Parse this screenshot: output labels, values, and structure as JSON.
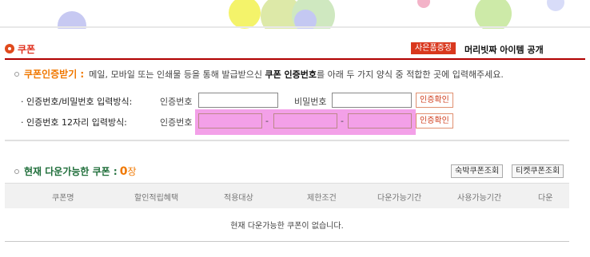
{
  "header": {
    "section_title": "쿠폰",
    "gift_badge": "사은품증정",
    "gift_link": "머리빗짜 아이템 공개"
  },
  "auth": {
    "title": "쿠폰인증받기 :",
    "desc_pre": "메일, 모바일 또는 인쇄물 등을 통해 발급받으신",
    "desc_bold": "쿠폰 인증번호",
    "desc_post": "를 아래 두 가지 양식 중 적합한 곳에 입력해주세요.",
    "line1": {
      "label": "· 인증번호/비밀번호 입력방식:",
      "code_label": "인증번호",
      "pw_label": "비밀번호",
      "confirm": "인증확인"
    },
    "line2": {
      "label": "· 인증번호 12자리 입력방식:",
      "code_label": "인증번호",
      "confirm": "인증확인"
    }
  },
  "current": {
    "title": "현재 다운가능한 쿠폰 :",
    "count": "0",
    "unit": "장",
    "btn_stay": "숙박쿠폰조회",
    "btn_ticket": "티켓쿠폰조회",
    "columns": [
      "쿠폰명",
      "할인적립혜택",
      "적용대상",
      "제한조건",
      "다운가능기간",
      "사용가능기간",
      "다운"
    ],
    "empty_text": "현재 다운가능한 쿠폰이 없습니다."
  }
}
